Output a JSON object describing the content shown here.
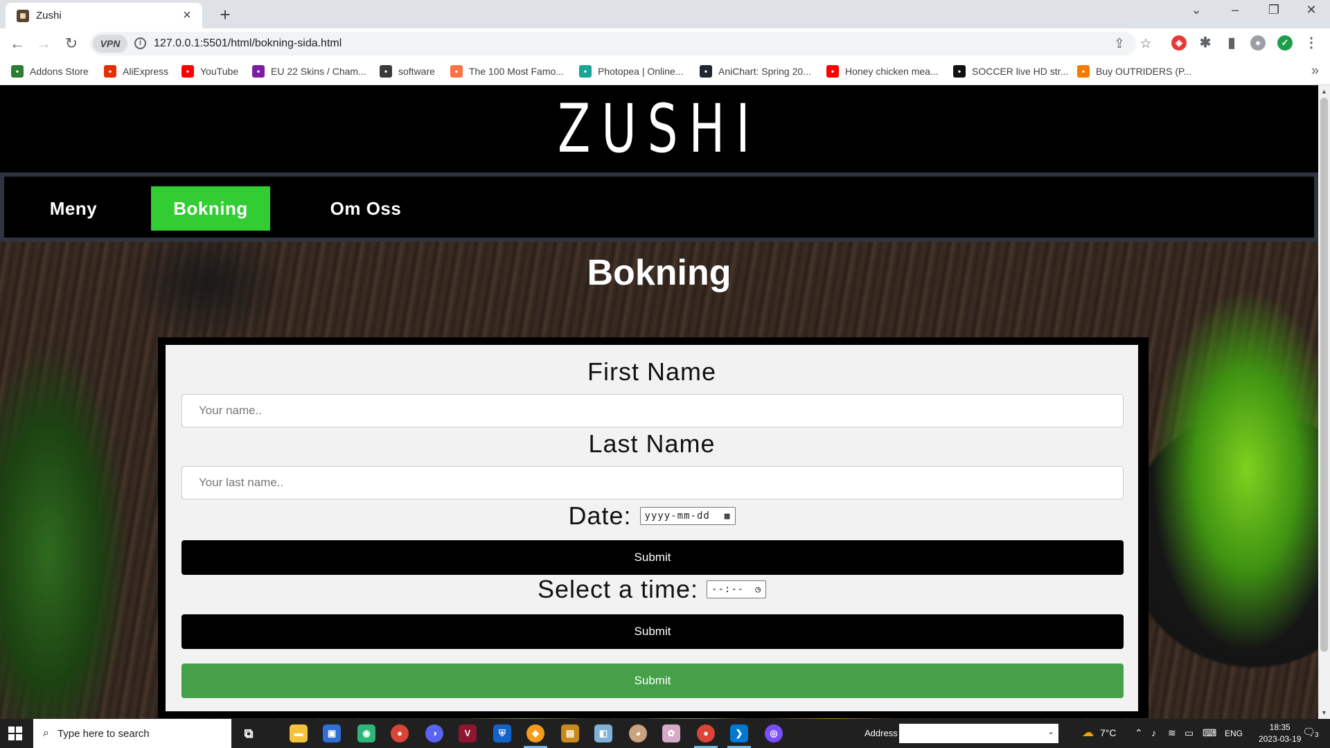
{
  "browser": {
    "tab_title": "Zushi",
    "url": "127.0.0.1:5501/html/bokning-sida.html",
    "vpn_label": "VPN",
    "bookmarks": [
      {
        "label": "Addons Store",
        "icon": "addons-store-icon",
        "color": "#2e7d32"
      },
      {
        "label": "AliExpress",
        "icon": "aliexpress-icon",
        "color": "#e62e04"
      },
      {
        "label": "YouTube",
        "icon": "youtube-icon",
        "color": "#ff0000"
      },
      {
        "label": "EU 22 Skins / Cham...",
        "icon": "eu-skins-icon",
        "color": "#7b1fa2"
      },
      {
        "label": "software",
        "icon": "software-icon",
        "color": "#3a3a3a"
      },
      {
        "label": "The 100 Most Famo...",
        "icon": "famous-icon",
        "color": "#ff7043"
      },
      {
        "label": "Photopea | Online...",
        "icon": "photopea-icon",
        "color": "#18a497"
      },
      {
        "label": "AniChart: Spring 20...",
        "icon": "anichart-icon",
        "color": "#1e2630"
      },
      {
        "label": "Honey chicken mea...",
        "icon": "youtube-icon",
        "color": "#ff0000"
      },
      {
        "label": "SOCCER live HD str...",
        "icon": "soccer-icon",
        "color": "#111111"
      },
      {
        "label": "Buy OUTRIDERS (P...",
        "icon": "outriders-icon",
        "color": "#f57c00"
      }
    ]
  },
  "site": {
    "logo": "ZUSHI",
    "nav": [
      {
        "label": "Meny",
        "active": false
      },
      {
        "label": "Bokning",
        "active": true
      },
      {
        "label": "Om Oss",
        "active": false
      }
    ],
    "page_title": "Bokning",
    "accent_green": "#32cd32",
    "submit_green": "#45a049"
  },
  "form": {
    "first_name_label": "First Name",
    "first_name_placeholder": "Your name..",
    "last_name_label": "Last Name",
    "last_name_placeholder": "Your last name..",
    "date_label": "Date:",
    "date_placeholder": "yyyy-mm-dd",
    "submit_1": "Submit",
    "time_label": "Select a time:",
    "time_placeholder": "--:--",
    "submit_2": "Submit",
    "submit_3": "Submit"
  },
  "taskbar": {
    "search_placeholder": "Type here to search",
    "address_label": "Address",
    "weather": "7°C",
    "language": "ENG",
    "time": "18:35",
    "date": "2023-03-19",
    "notification_count": "3"
  }
}
